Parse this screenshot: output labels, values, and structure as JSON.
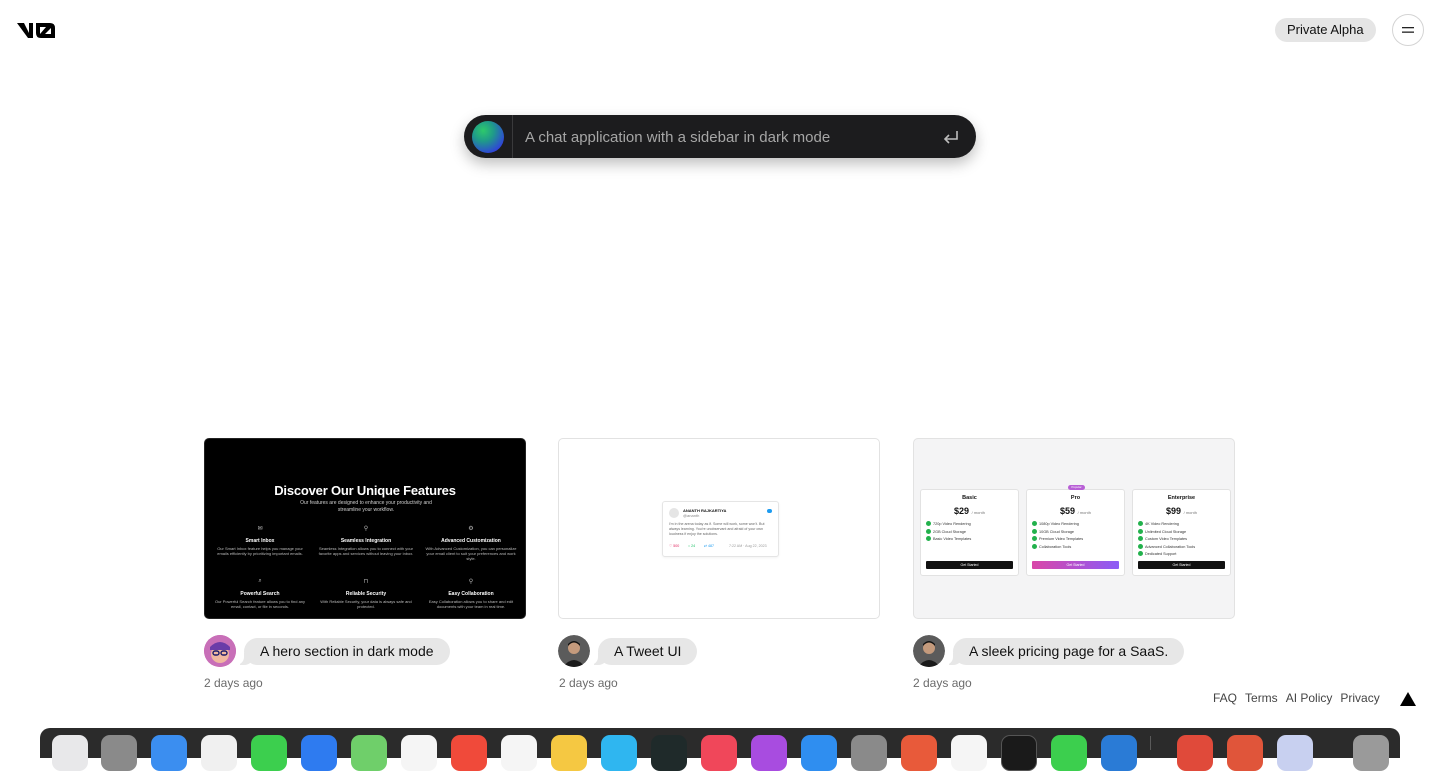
{
  "header": {
    "logo_label": "v0",
    "badge": "Private Alpha",
    "menu_icon": "menu-icon"
  },
  "prompt": {
    "placeholder": "A chat application with a sidebar in dark mode",
    "submit_icon": "enter-icon"
  },
  "examples": [
    {
      "caption": "A hero section in dark mode",
      "time": "2 days ago",
      "preview": {
        "title": "Discover Our Unique Features",
        "subtitle": "Our features are designed to enhance your productivity and streamline your workflow.",
        "features": [
          {
            "title": "Smart Inbox",
            "desc": "Our Smart Inbox feature helps you manage your emails efficiently by prioritizing important emails."
          },
          {
            "title": "Seamless Integration",
            "desc": "Seamless Integration allows you to connect with your favorite apps and services without leaving your inbox."
          },
          {
            "title": "Advanced Customization",
            "desc": "With Advanced Customization, you can personalize your email client to suit your preferences and work style."
          },
          {
            "title": "Powerful Search",
            "desc": "Our Powerful Search feature allows you to find any email, contact, or file in seconds."
          },
          {
            "title": "Reliable Security",
            "desc": "With Reliable Security, your data is always safe and protected."
          },
          {
            "title": "Easy Collaboration",
            "desc": "Easy Collaboration allows you to share and edit documents with your team in real time."
          }
        ]
      }
    },
    {
      "caption": "A Tweet UI",
      "time": "2 days ago",
      "preview": {
        "name": "ANANTH RAJKARTIYA",
        "handle": "@ananth",
        "text": "I'm in the arena today as if. Some will work, some won't. But always learning. You're unobservant and afraid of your own loudness if enjoy the solutions.",
        "likes": "500",
        "replies": "24",
        "retweets": "487",
        "date": "7:22 AM · Aug 22, 2023"
      }
    },
    {
      "caption": "A sleek pricing page for a SaaS.",
      "time": "2 days ago",
      "preview": {
        "plans": [
          {
            "name": "Basic",
            "price": "$29",
            "period": "/ month",
            "features": [
              "720p Video Rendering",
              "2GB Cloud Storage",
              "Basic Video Templates"
            ],
            "cta": "Get Started"
          },
          {
            "name": "Pro",
            "price": "$59",
            "period": "/ month",
            "badge": "Popular",
            "features": [
              "1080p Video Rendering",
              "10GB Cloud Storage",
              "Premium Video Templates",
              "Collaboration Tools"
            ],
            "cta": "Get Started"
          },
          {
            "name": "Enterprise",
            "price": "$99",
            "period": "/ month",
            "features": [
              "4K Video Rendering",
              "Unlimited Cloud Storage",
              "Custom Video Templates",
              "Advanced Collaboration Tools",
              "Dedicated Support"
            ],
            "cta": "Get Started"
          }
        ]
      }
    }
  ],
  "footer": {
    "links": [
      "FAQ",
      "Terms",
      "AI Policy",
      "Privacy"
    ],
    "vercel_icon": "vercel-triangle-icon"
  },
  "colors": {
    "prompt_bg": "#1c1c1e",
    "badge_bg": "#e5e5e5",
    "bubble_bg": "#e7e7e7",
    "accent_line": "#1f5f5f"
  }
}
